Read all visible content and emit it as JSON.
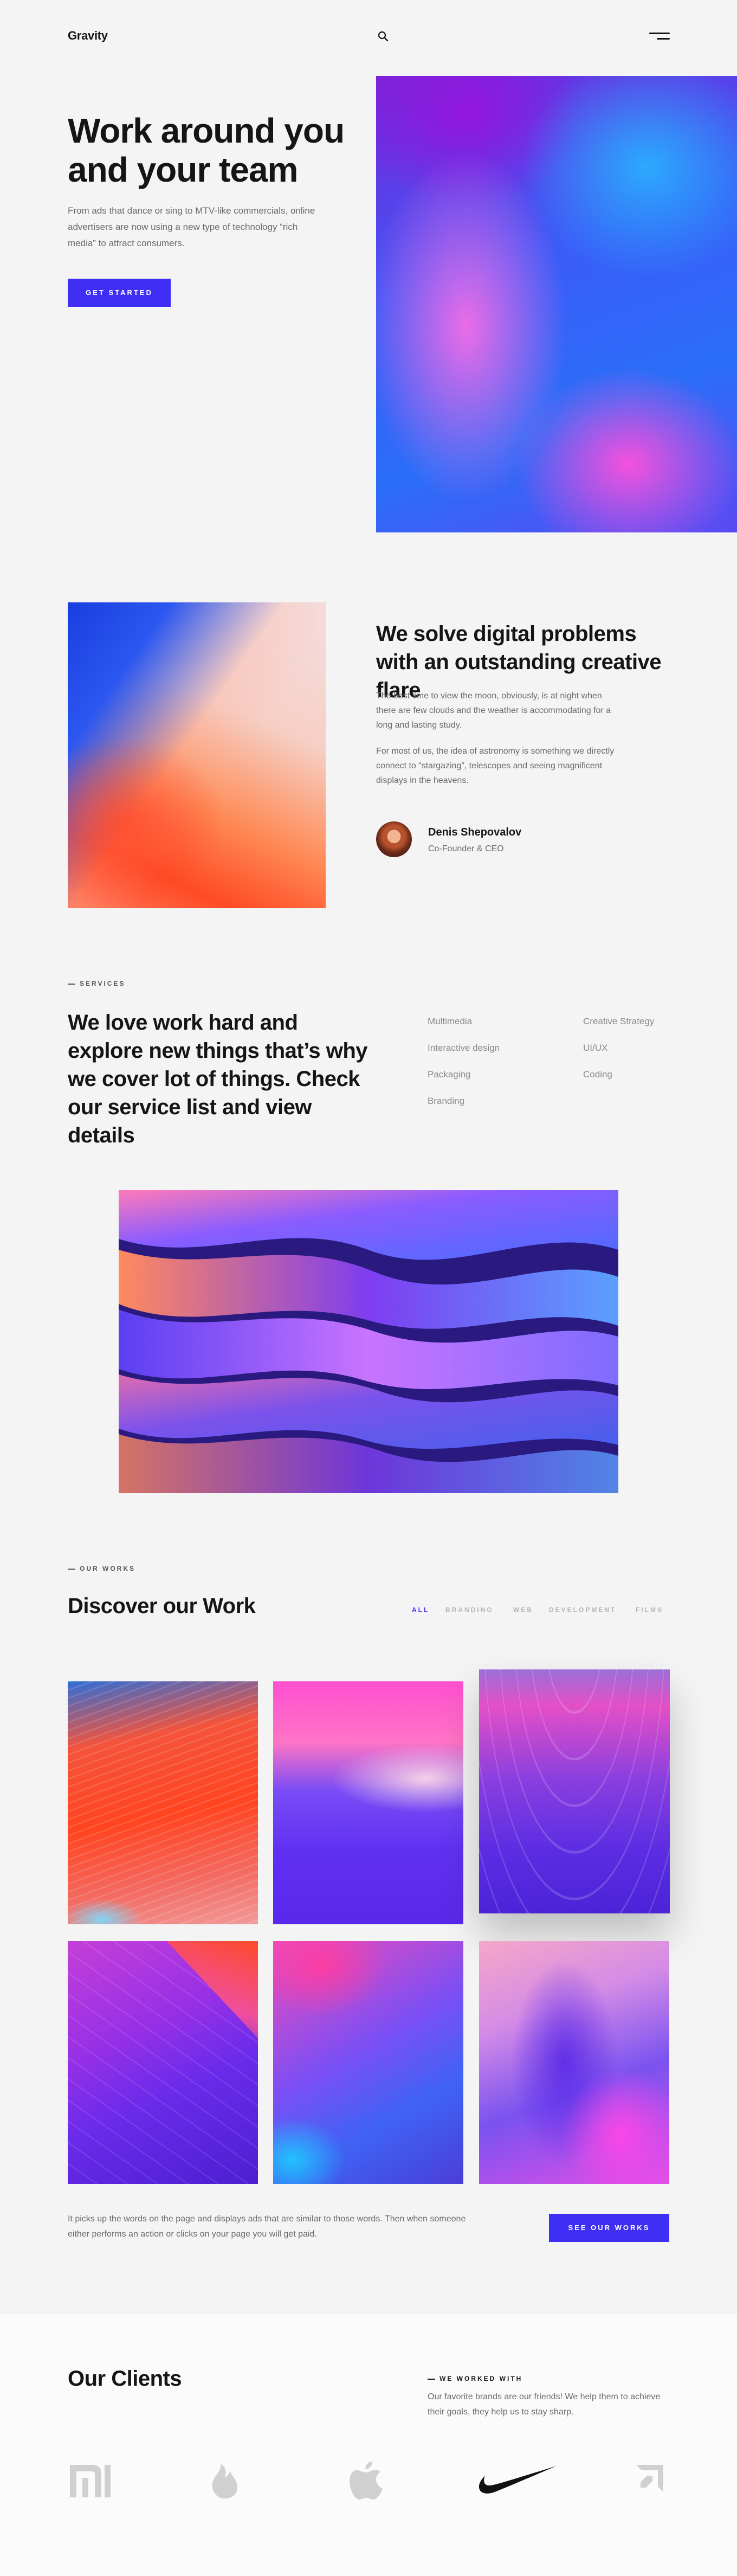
{
  "header": {
    "logo": "Gravity",
    "search_icon": "search-icon",
    "menu_icon": "hamburger-menu-icon"
  },
  "hero": {
    "title": "Work around you and your team",
    "text": "From ads that dance or sing to MTV-like commercials, online advertisers are now using a new type of technology “rich media” to attract consumers.",
    "button": "GET STARTED"
  },
  "about": {
    "title": "We solve digital problems with an outstanding creative flare",
    "p1": "The best time to view the moon, obviously, is at night when there are few clouds and the weather is accommodating for a long and lasting study.",
    "p2": "For most of us, the idea of astronomy is something we directly connect to “stargazing”, telescopes and seeing magnificent displays in the heavens.",
    "author_name": "Denis Shepovalov",
    "author_role": "Co-Founder & CEO"
  },
  "services": {
    "eyebrow": "SERVICES",
    "title": "We love work hard and explore new things that’s why we cover lot of things. Check our service list and view details",
    "items": [
      "Multimedia",
      "Creative Strategy",
      "Interactive design",
      "UI/UX",
      "Packaging",
      "Coding",
      "Branding"
    ]
  },
  "works": {
    "eyebrow": "OUR WORKS",
    "title": "Discover our Work",
    "filters": [
      "ALL",
      "BRANDING",
      "WEB",
      "DEVELOPMENT",
      "FILMS"
    ],
    "text": "It picks up the words on the page and displays ads that are similar to those words. Then when someone either performs an action or clicks on your page you will get paid.",
    "button": "SEE OUR WORKS"
  },
  "clients": {
    "title": "Our Clients",
    "eyebrow": "WE WORKED WITH",
    "text": "Our favorite brands are our friends! We help them to achieve their goals, they help us to stay sharp.",
    "logos": [
      "xiaomi-logo",
      "tinder-logo",
      "apple-logo",
      "nike-logo",
      "amd-logo"
    ]
  },
  "colors": {
    "accent": "#3f2ff5",
    "background": "#f4f4f4",
    "text": "#151515",
    "muted": "#6a6a6a"
  }
}
